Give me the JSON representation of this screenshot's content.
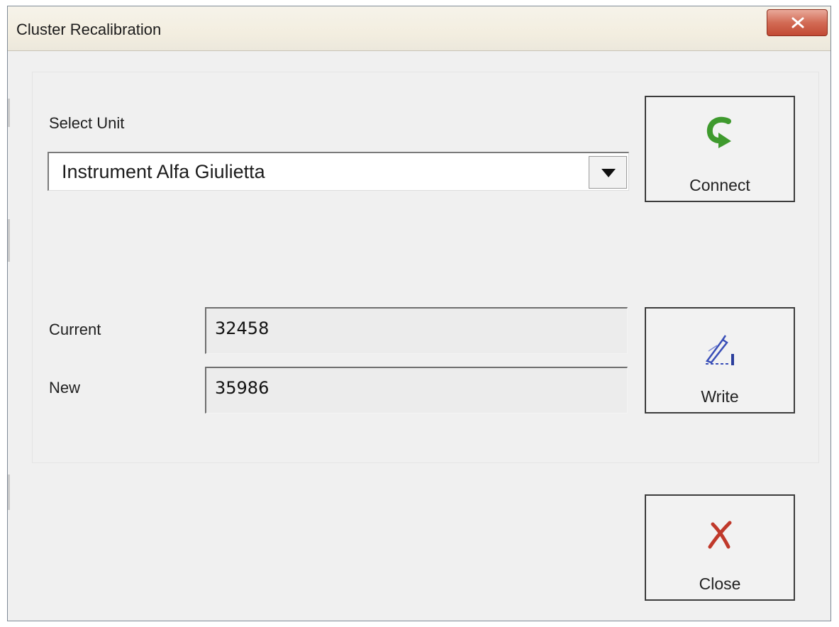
{
  "window": {
    "title": "Cluster Recalibration"
  },
  "form": {
    "select_unit_label": "Select Unit",
    "unit_selected": "Instrument Alfa Giulietta",
    "current_label": "Current",
    "current_value": "32458",
    "new_label": "New",
    "new_value": "35986"
  },
  "buttons": {
    "connect": {
      "label": "Connect",
      "icon": "connect-arrow-icon",
      "color": "#3f9a2e"
    },
    "write": {
      "label": "Write",
      "icon": "pen-write-icon",
      "color": "#3a4fb8"
    },
    "close": {
      "label": "Close",
      "icon": "red-x-icon",
      "color": "#c0392b"
    }
  }
}
